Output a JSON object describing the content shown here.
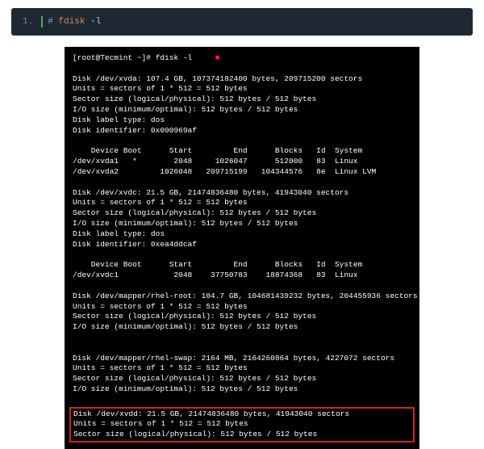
{
  "codeblock": {
    "line_number": "1.",
    "hash": "#",
    "command": "fdisk",
    "flag": "-l"
  },
  "terminal": {
    "prompt": "[root@Tecmint ~]# fdisk -l",
    "disk_xvda": {
      "header": "Disk /dev/xvda: 107.4 GB, 107374182400 bytes, 209715200 sectors",
      "units": "Units = sectors of 1 * 512 = 512 bytes",
      "sector": "Sector size (logical/physical): 512 bytes / 512 bytes",
      "io": "I/O size (minimum/optimal): 512 bytes / 512 bytes",
      "label": "Disk label type: dos",
      "ident": "Disk identifier: 0x000969af"
    },
    "table1_header": "    Device Boot      Start         End      Blocks   Id  System",
    "table1_row1": "/dev/xvda1   *        2048     1026047      512000   83  Linux",
    "table1_row2": "/dev/xvda2         1026048   209715199   104344576   8e  Linux LVM",
    "disk_xvdc": {
      "header": "Disk /dev/xvdc: 21.5 GB, 21474836480 bytes, 41943040 sectors",
      "units": "Units = sectors of 1 * 512 = 512 bytes",
      "sector": "Sector size (logical/physical): 512 bytes / 512 bytes",
      "io": "I/O size (minimum/optimal): 512 bytes / 512 bytes",
      "label": "Disk label type: dos",
      "ident": "Disk identifier: 0xea4ddcaf"
    },
    "table2_header": "    Device Boot      Start         End      Blocks   Id  System",
    "table2_row1": "/dev/xvdc1            2048    37750783    18874368   83  Linux",
    "mapper_root": {
      "header": "Disk /dev/mapper/rhel-root: 104.7 GB, 104681439232 bytes, 204455936 sectors",
      "units": "Units = sectors of 1 * 512 = 512 bytes",
      "sector": "Sector size (logical/physical): 512 bytes / 512 bytes",
      "io": "I/O size (minimum/optimal): 512 bytes / 512 bytes"
    },
    "mapper_swap": {
      "header": "Disk /dev/mapper/rhel-swap: 2164 MB, 2164260864 bytes, 4227072 sectors",
      "units": "Units = sectors of 1 * 512 = 512 bytes",
      "sector": "Sector size (logical/physical): 512 bytes / 512 bytes",
      "io": "I/O size (minimum/optimal): 512 bytes / 512 bytes"
    },
    "highlighted": {
      "header": "Disk /dev/xvdd: 21.5 GB, 21474836480 bytes, 41943040 sectors",
      "units": "Units = sectors of 1 * 512 = 512 bytes",
      "sector": "Sector size (logical/physical): 512 bytes / 512 bytes"
    }
  }
}
